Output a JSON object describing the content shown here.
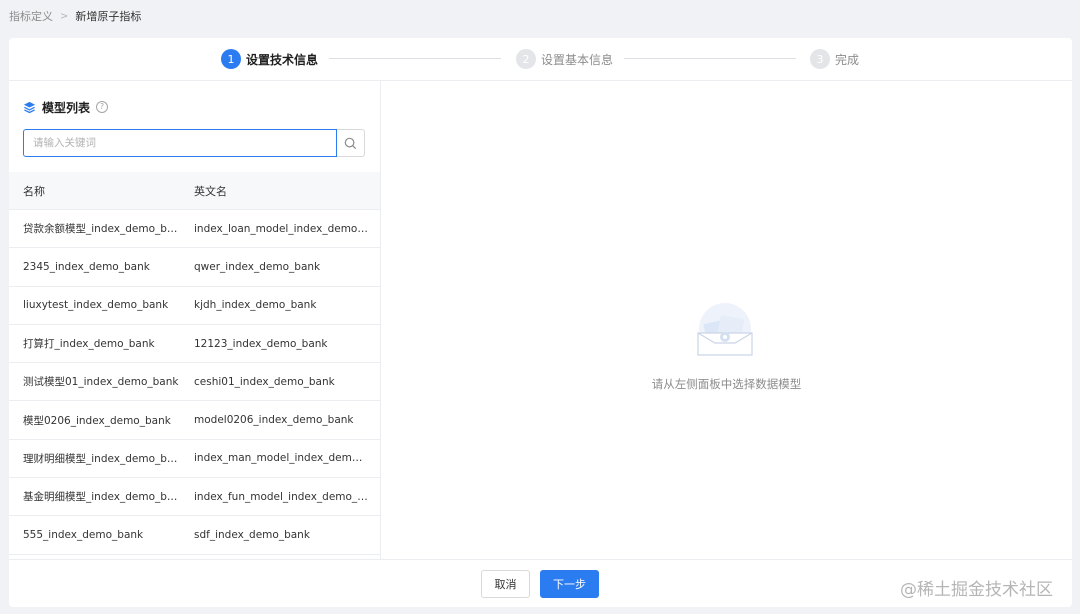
{
  "breadcrumb": {
    "parent": "指标定义",
    "current": "新增原子指标"
  },
  "steps": [
    {
      "number": "1",
      "label": "设置技术信息",
      "state": "active"
    },
    {
      "number": "2",
      "label": "设置基本信息",
      "state": "inactive"
    },
    {
      "number": "3",
      "label": "完成",
      "state": "inactive"
    }
  ],
  "model_panel": {
    "title": "模型列表",
    "help_glyph": "?",
    "search_placeholder": "请输入关键词",
    "columns": {
      "name": "名称",
      "english_name": "英文名"
    },
    "rows": [
      {
        "name": "贷款余额模型_index_demo_bank",
        "english_name": "index_loan_model_index_demo_bank"
      },
      {
        "name": "2345_index_demo_bank",
        "english_name": "qwer_index_demo_bank"
      },
      {
        "name": "liuxytest_index_demo_bank",
        "english_name": "kjdh_index_demo_bank"
      },
      {
        "name": "打算打_index_demo_bank",
        "english_name": "12123_index_demo_bank"
      },
      {
        "name": "测试模型01_index_demo_bank",
        "english_name": "ceshi01_index_demo_bank"
      },
      {
        "name": "模型0206_index_demo_bank",
        "english_name": "model0206_index_demo_bank"
      },
      {
        "name": "理财明细模型_index_demo_bank",
        "english_name": "index_man_model_index_demo_bank"
      },
      {
        "name": "基金明细模型_index_demo_bank",
        "english_name": "index_fun_model_index_demo_bank"
      },
      {
        "name": "555_index_demo_bank",
        "english_name": "sdf_index_demo_bank"
      }
    ]
  },
  "empty_state": {
    "message": "请从左侧面板中选择数据模型",
    "icon": "empty-box-illustration"
  },
  "footer": {
    "cancel_label": "取消",
    "next_label": "下一步"
  },
  "watermark": "@稀土掘金技术社区",
  "colors": {
    "primary": "#2b7cf0",
    "page_bg": "#f0f2f5",
    "border": "#ebedf0",
    "muted_text": "#8c8c8c"
  }
}
